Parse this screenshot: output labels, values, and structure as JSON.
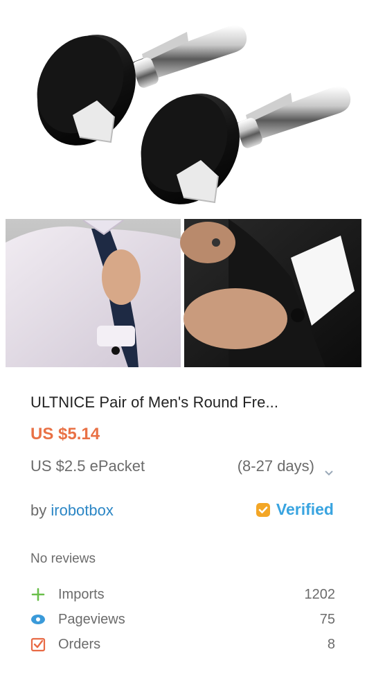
{
  "product": {
    "title": "ULTNICE Pair of Men's Round Fre...",
    "price": "US $5.14",
    "shipping": "US $2.5 ePacket",
    "delivery": "(8-27 days)",
    "seller_prefix": "by",
    "seller": "irobotbox",
    "verified": "Verified",
    "reviews": "No reviews"
  },
  "stats": [
    {
      "label": "Imports",
      "value": "1202",
      "icon": "plus-icon"
    },
    {
      "label": "Pageviews",
      "value": "75",
      "icon": "eye-icon"
    },
    {
      "label": "Orders",
      "value": "8",
      "icon": "order-check-icon"
    }
  ],
  "colors": {
    "price": "#e97145",
    "seller_link": "#2b86c5",
    "verified": "#39a4e0",
    "verified_badge": "#f3a626",
    "imports_icon": "#6abf4b",
    "pageviews_icon": "#3a9ad9",
    "orders_icon": "#e86a45"
  }
}
